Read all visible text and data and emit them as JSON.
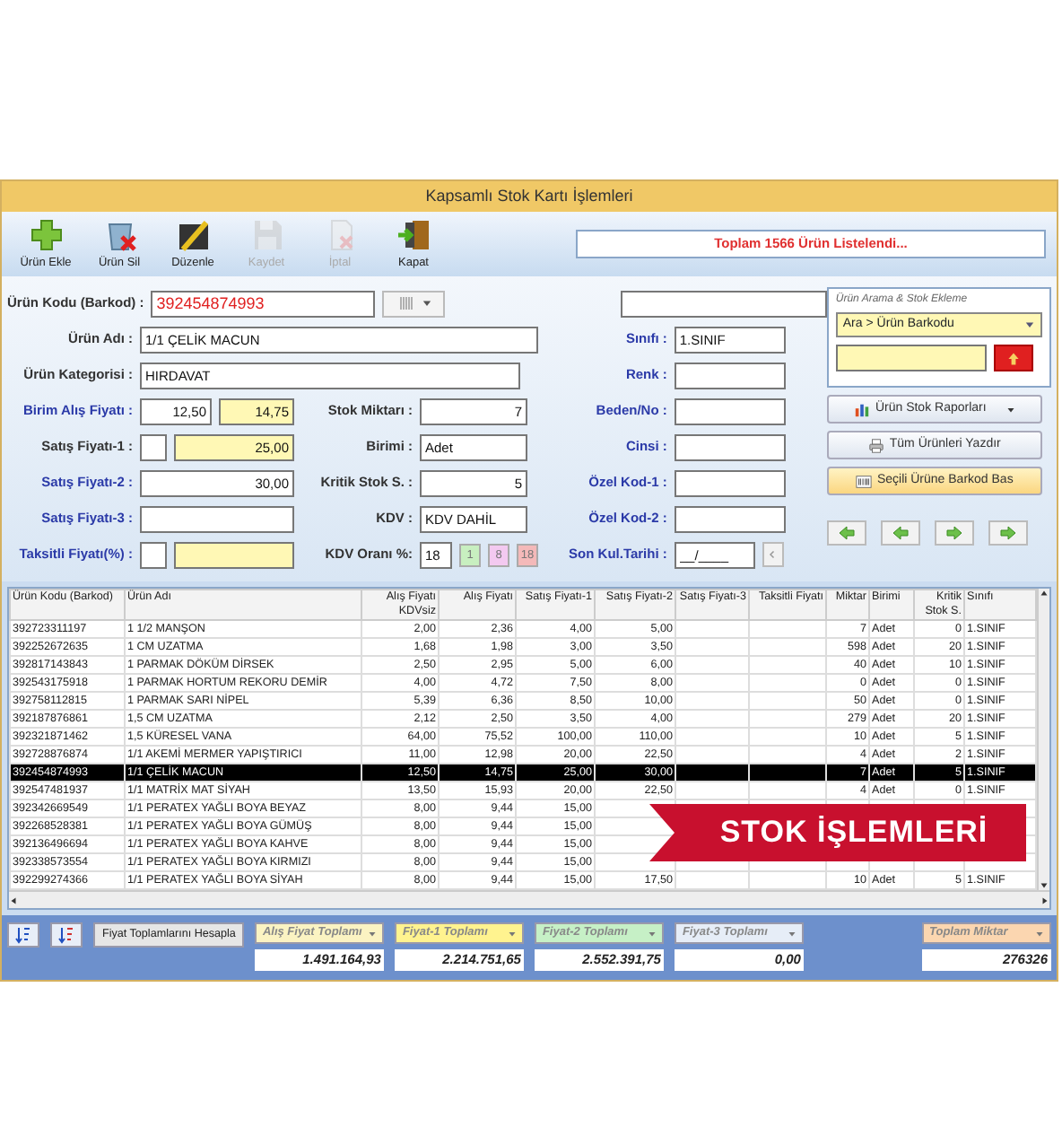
{
  "window": {
    "title": "Kapsamlı Stok Kartı İşlemleri"
  },
  "toolbar": [
    {
      "label": "Ürün Ekle",
      "kind": "add",
      "disabled": false
    },
    {
      "label": "Ürün Sil",
      "kind": "delete",
      "disabled": false
    },
    {
      "label": "Düzenle",
      "kind": "edit",
      "disabled": false
    },
    {
      "label": "Kaydet",
      "kind": "save",
      "disabled": true
    },
    {
      "label": "İptal",
      "kind": "cancel",
      "disabled": true
    },
    {
      "label": "Kapat",
      "kind": "exit",
      "disabled": false
    }
  ],
  "status_message": "Toplam 1566 Ürün Listelendi...",
  "form": {
    "barcode": {
      "label": "Ürün Kodu (Barkod) :",
      "value": "392454874993"
    },
    "name": {
      "label": "Ürün Adı :",
      "value": "1/1 ÇELİK MACUN"
    },
    "category": {
      "label": "Ürün Kategorisi :",
      "value": "HIRDAVAT"
    },
    "purchase_price": {
      "label": "Birim Alış Fiyatı :",
      "value": "12,50",
      "value_with_vat": "14,75"
    },
    "price_1": {
      "label": "Satış Fiyatı-1 :",
      "value": "25,00"
    },
    "price_2": {
      "label": "Satış Fiyatı-2 :",
      "value": "30,00"
    },
    "price_3": {
      "label": "Satış Fiyatı-3 :"
    },
    "installment": {
      "label": "Taksitli Fiyatı(%) :"
    },
    "stock": {
      "label": "Stok Miktarı :",
      "value": "7"
    },
    "unit": {
      "label": "Birimi :",
      "value": "Adet"
    },
    "critical": {
      "label": "Kritik Stok S. :",
      "value": "5"
    },
    "vat": {
      "label": "KDV :",
      "value": "KDV DAHİL"
    },
    "vat_rate": {
      "label": "KDV Oranı %:",
      "value": "18",
      "options": [
        {
          "label": "1",
          "color": "#c8efc0"
        },
        {
          "label": "8",
          "color": "#f3c9f0"
        },
        {
          "label": "18",
          "color": "#f4b9b9"
        }
      ]
    },
    "class": {
      "label": "Sınıfı :",
      "value": "1.SINIF"
    },
    "color": {
      "label": "Renk :"
    },
    "size": {
      "label": "Beden/No :"
    },
    "type": {
      "label": "Cinsi :"
    },
    "code_1": {
      "label": "Özel Kod-1 :"
    },
    "code_2": {
      "label": "Özel Kod-2 :"
    },
    "expiry": {
      "label": "Son Kul.Tarihi :",
      "value": "__/____"
    }
  },
  "search_panel": {
    "title": "Ürün Arama & Stok Ekleme",
    "mode": "Ara > Ürün Barkodu"
  },
  "actions": [
    {
      "label": "Ürün Stok Raporları",
      "kind": "report"
    },
    {
      "label": "Tüm Ürünleri Yazdır",
      "kind": "print"
    },
    {
      "label": "Seçili Ürüne Barkod Bas",
      "kind": "barcode"
    }
  ],
  "table": {
    "columns": [
      "Ürün Kodu (Barkod)",
      "Ürün Adı",
      "Alış Fiyatı KDVsiz",
      "Alış Fiyatı",
      "Satış Fiyatı-1",
      "Satış Fiyatı-2",
      "Satış Fiyatı-3",
      "Taksitli Fiyatı",
      "Miktar",
      "Birimi",
      "Kritik Stok S.",
      "Sınıfı"
    ],
    "rows": [
      {
        "selected": false,
        "cells": [
          "392723311197",
          "1 1/2 MANŞON",
          "2,00",
          "2,36",
          "4,00",
          "5,00",
          null,
          null,
          "7",
          "Adet",
          "0",
          "1.SINIF"
        ]
      },
      {
        "selected": false,
        "cells": [
          "392252672635",
          "1 CM UZATMA",
          "1,68",
          "1,98",
          "3,00",
          "3,50",
          null,
          null,
          "598",
          "Adet",
          "20",
          "1.SINIF"
        ]
      },
      {
        "selected": false,
        "cells": [
          "392817143843",
          "1 PARMAK DÖKÜM DİRSEK",
          "2,50",
          "2,95",
          "5,00",
          "6,00",
          null,
          null,
          "40",
          "Adet",
          "10",
          "1.SINIF"
        ]
      },
      {
        "selected": false,
        "cells": [
          "392543175918",
          "1 PARMAK HORTUM REKORU DEMİR",
          "4,00",
          "4,72",
          "7,50",
          "8,00",
          null,
          null,
          "0",
          "Adet",
          "0",
          "1.SINIF"
        ]
      },
      {
        "selected": false,
        "cells": [
          "392758112815",
          "1 PARMAK SARI NİPEL",
          "5,39",
          "6,36",
          "8,50",
          "10,00",
          null,
          null,
          "50",
          "Adet",
          "0",
          "1.SINIF"
        ]
      },
      {
        "selected": false,
        "cells": [
          "392187876861",
          "1,5 CM UZATMA",
          "2,12",
          "2,50",
          "3,50",
          "4,00",
          null,
          null,
          "279",
          "Adet",
          "20",
          "1.SINIF"
        ]
      },
      {
        "selected": false,
        "cells": [
          "392321871462",
          "1,5 KÜRESEL VANA",
          "64,00",
          "75,52",
          "100,00",
          "110,00",
          null,
          null,
          "10",
          "Adet",
          "5",
          "1.SINIF"
        ]
      },
      {
        "selected": false,
        "cells": [
          "392728876874",
          "1/1 AKEMİ MERMER YAPIŞTIRICI",
          "11,00",
          "12,98",
          "20,00",
          "22,50",
          null,
          null,
          "4",
          "Adet",
          "2",
          "1.SINIF"
        ]
      },
      {
        "selected": true,
        "cells": [
          "392454874993",
          "1/1 ÇELİK MACUN",
          "12,50",
          "14,75",
          "25,00",
          "30,00",
          null,
          null,
          "7",
          "Adet",
          "5",
          "1.SINIF"
        ]
      },
      {
        "selected": false,
        "cells": [
          "392547481937",
          "1/1 MATRİX MAT SİYAH",
          "13,50",
          "15,93",
          "20,00",
          "22,50",
          null,
          null,
          "4",
          "Adet",
          "0",
          "1.SINIF"
        ]
      },
      {
        "selected": false,
        "cells": [
          "392342669549",
          "1/1 PERATEX YAĞLI BOYA BEYAZ",
          "8,00",
          "9,44",
          "15,00",
          null,
          null,
          null,
          null,
          null,
          null,
          null
        ]
      },
      {
        "selected": false,
        "cells": [
          "392268528381",
          "1/1 PERATEX YAĞLI BOYA GÜMÜŞ",
          "8,00",
          "9,44",
          "15,00",
          null,
          null,
          null,
          null,
          null,
          null,
          null
        ]
      },
      {
        "selected": false,
        "cells": [
          "392136496694",
          "1/1 PERATEX YAĞLI BOYA KAHVE",
          "8,00",
          "9,44",
          "15,00",
          null,
          null,
          null,
          null,
          null,
          null,
          null
        ]
      },
      {
        "selected": false,
        "cells": [
          "392338573554",
          "1/1 PERATEX YAĞLI BOYA KIRMIZI",
          "8,00",
          "9,44",
          "15,00",
          null,
          null,
          null,
          null,
          null,
          null,
          null
        ]
      },
      {
        "selected": false,
        "cells": [
          "392299274366",
          "1/1 PERATEX YAĞLI BOYA SİYAH",
          "8,00",
          "9,44",
          "15,00",
          "17,50",
          null,
          null,
          "10",
          "Adet",
          "5",
          "1.SINIF"
        ]
      }
    ]
  },
  "calc_button": "Fiyat Toplamlarını Hesapla",
  "totals": [
    {
      "label": "Alış Fiyat Toplamı",
      "value": "1.491.164,93",
      "color": "#fbf3c2"
    },
    {
      "label": "Fiyat-1 Toplamı",
      "value": "2.214.751,65",
      "color": "#fff38f"
    },
    {
      "label": "Fiyat-2 Toplamı",
      "value": "2.552.391,75",
      "color": "#c6f0c6"
    },
    {
      "label": "Fiyat-3 Toplamı",
      "value": "0,00",
      "color": "#e6edf7"
    },
    {
      "label": "Toplam Miktar",
      "value": "276326",
      "color": "#fbd6b0"
    }
  ],
  "banner": "STOK İŞLEMLERİ"
}
